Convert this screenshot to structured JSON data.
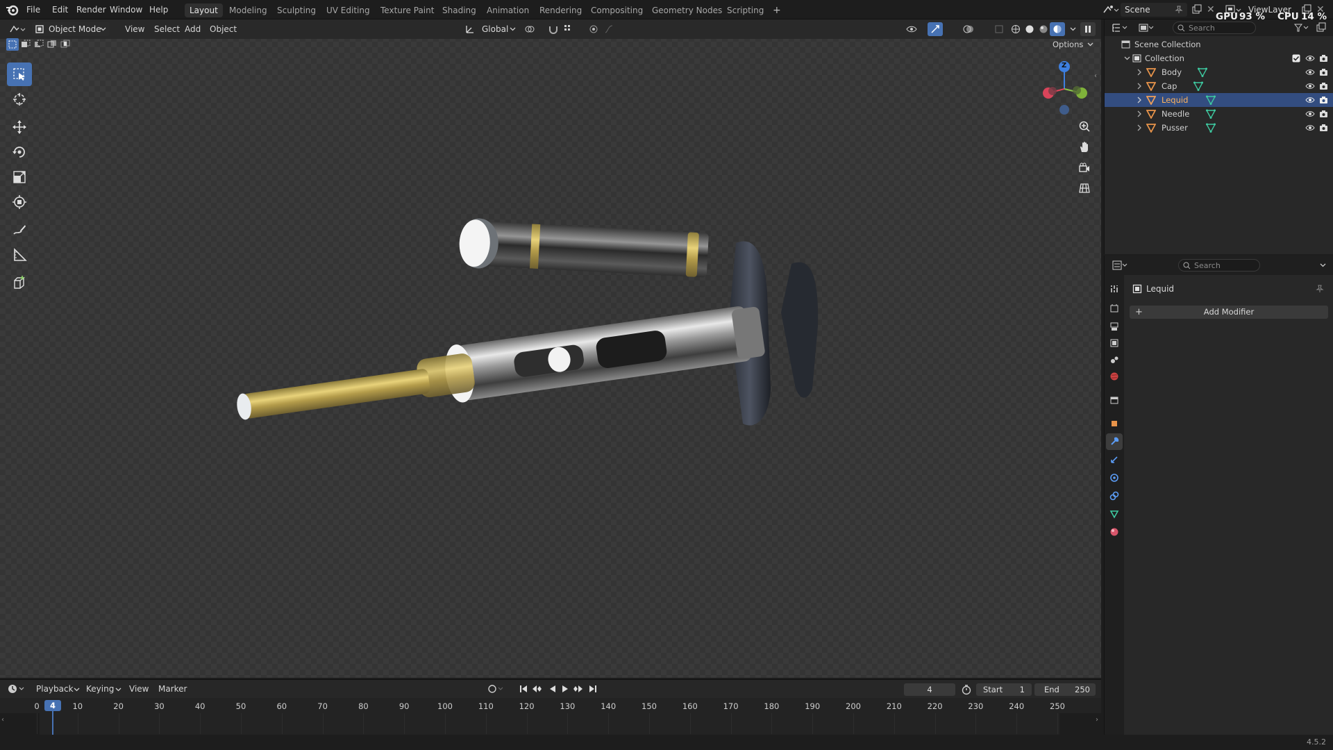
{
  "topbar": {
    "menus": [
      "File",
      "Edit",
      "Render",
      "Window",
      "Help"
    ],
    "workspaces": [
      "Layout",
      "Modeling",
      "Sculpting",
      "UV Editing",
      "Texture Paint",
      "Shading",
      "Animation",
      "Rendering",
      "Compositing",
      "Geometry Nodes",
      "Scripting"
    ],
    "active_workspace": "Layout",
    "add_tab": "+",
    "scene": "Scene",
    "view_layer": "ViewLayer",
    "gpu_label": "GPU",
    "gpu_value": "93 %",
    "cpu_label": "CPU",
    "cpu_value": "14 %"
  },
  "viewport": {
    "mode": "Object Mode",
    "menus": [
      "View",
      "Select",
      "Add",
      "Object"
    ],
    "orientation": "Global",
    "options": "Options",
    "gizmo_z": "Z",
    "tools": [
      "select-box",
      "cursor",
      "move",
      "rotate",
      "scale",
      "transform",
      "annotate",
      "measure",
      "add-cube"
    ],
    "accent_color": "#4772b3"
  },
  "outliner": {
    "search_placeholder": "Search",
    "root": "Scene Collection",
    "collection": "Collection",
    "objects": [
      "Body",
      "Cap",
      "Lequid",
      "Needle",
      "Pusser"
    ],
    "selected": "Lequid"
  },
  "properties": {
    "search_placeholder": "Search",
    "object_name": "Lequid",
    "add_modifier": "Add Modifier"
  },
  "timeline": {
    "menus": [
      "Playback",
      "Keying",
      "View",
      "Marker"
    ],
    "current_frame": "4",
    "start_label": "Start",
    "start": "1",
    "end_label": "End",
    "end": "250",
    "ticks": [
      "0",
      "10",
      "20",
      "30",
      "40",
      "50",
      "60",
      "70",
      "80",
      "90",
      "100",
      "110",
      "120",
      "130",
      "140",
      "150",
      "160",
      "170",
      "180",
      "190",
      "200",
      "210",
      "220",
      "230",
      "240",
      "250"
    ]
  },
  "status": {
    "version": "4.5.2"
  }
}
